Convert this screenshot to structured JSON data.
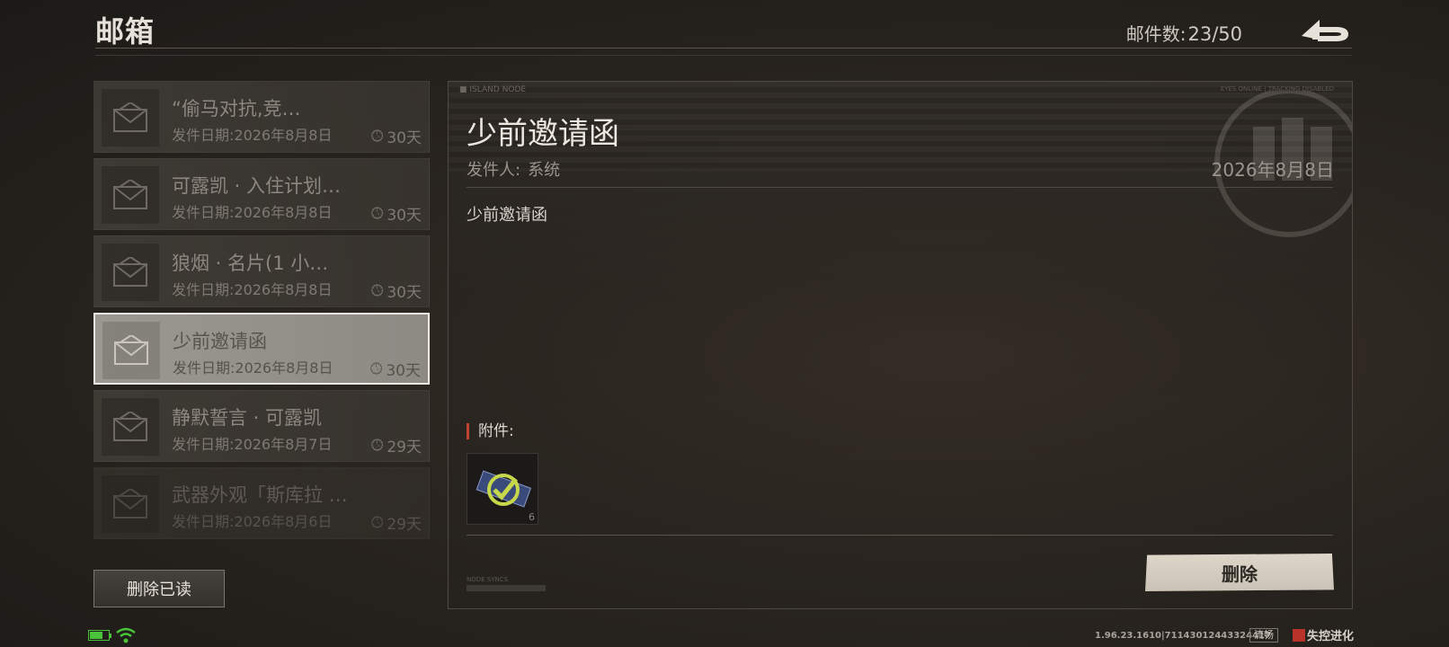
{
  "header": {
    "title": "邮箱",
    "mail_count_label": "邮件数:",
    "mail_count_value": "23/50",
    "back_icon": "back-arrow-icon"
  },
  "mail_list": {
    "items": [
      {
        "subject": "“偷马对抗,竞…",
        "date": "发件日期:2026年8月8日",
        "expire": "30天",
        "selected": false
      },
      {
        "subject": "可露凯 · 入住计划…",
        "date": "发件日期:2026年8月8日",
        "expire": "30天",
        "selected": false
      },
      {
        "subject": "狼烟 · 名片(1 小…",
        "date": "发件日期:2026年8月8日",
        "expire": "30天",
        "selected": false
      },
      {
        "subject": "少前邀请函",
        "date": "发件日期:2026年8月8日",
        "expire": "30天",
        "selected": true
      },
      {
        "subject": "静默誓言 · 可露凯",
        "date": "发件日期:2026年8月7日",
        "expire": "29天",
        "selected": false
      },
      {
        "subject": "武器外观「斯库拉 …",
        "date": "发件日期:2026年8月6日",
        "expire": "29天",
        "selected": false
      }
    ],
    "delete_read_label": "删除已读"
  },
  "detail": {
    "corner_left": "■ ISLAND NODE",
    "corner_right": "EYES ONLINE | TRACKING DISABLED",
    "title": "少前邀请函",
    "sender_label": "发件人:",
    "sender_value": "系统",
    "date": "2026年8月8日",
    "body": "少前邀请函",
    "attachments_label": "附件:",
    "attachment_qty": "6",
    "small_tag": "NODE SYNCS",
    "delete_label": "删除"
  },
  "status": {
    "version": "1.96.23.1610|71143012443324417",
    "perf": "流畅",
    "logo_text": "失控进化",
    "colors": {
      "battery": "#49c43a",
      "wifi": "#49c43a",
      "accent": "#c0452f"
    }
  }
}
